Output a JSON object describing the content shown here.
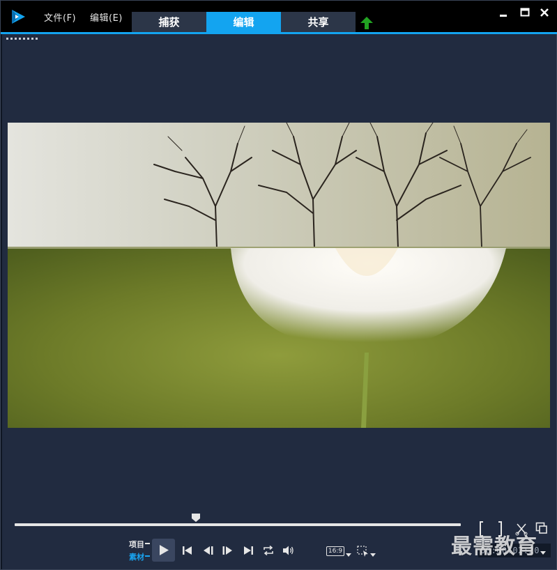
{
  "menu": {
    "file": "文件(F)",
    "edit": "编辑(E)"
  },
  "tabs": [
    {
      "label": "捕获",
      "active": false
    },
    {
      "label": "编辑",
      "active": true
    },
    {
      "label": "共享",
      "active": false
    }
  ],
  "player": {
    "mode_project": "项目",
    "mode_clip": "素材",
    "aspect_ratio": "16:9",
    "timecode": "00:00:02:20",
    "playhead_fraction": 0.41
  },
  "watermark": "最需教育",
  "colors": {
    "accent": "#13a4f0",
    "panel": "#212b40",
    "tab": "#2c3648",
    "upload": "#22a322"
  },
  "icons": [
    "app-logo-icon",
    "upload-icon",
    "minimize-icon",
    "maximize-icon",
    "close-icon",
    "play-icon",
    "go-to-start-icon",
    "previous-frame-icon",
    "next-frame-icon",
    "go-to-end-icon",
    "repeat-icon",
    "volume-icon",
    "crop-icon",
    "split-clip-icon",
    "external-preview-icon"
  ]
}
